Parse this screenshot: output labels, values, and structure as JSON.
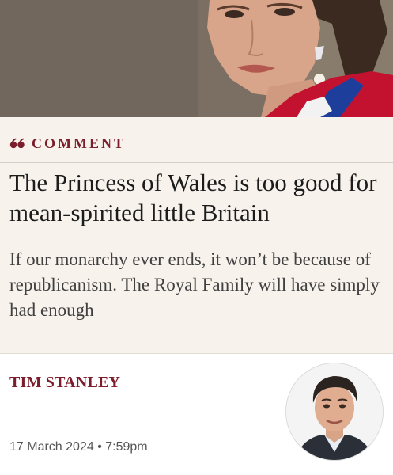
{
  "hero": {
    "image_icon": "portrait-photo"
  },
  "article": {
    "kicker": "COMMENT",
    "kicker_icon": "quote-icon",
    "headline": "The Princess of Wales is too good for mean-spirited little Britain",
    "standfirst": "If our monarchy ever ends, it won’t be because of republicanism. The Royal Family will have simply had enough",
    "author": "TIM STANLEY",
    "date": "17 March 2024",
    "separator": "•",
    "time": "7:59pm",
    "author_avatar_icon": "author-photo"
  },
  "colors": {
    "accent": "#7c1d2b",
    "band_background": "#f7f2ec",
    "headline": "#1c1c1c",
    "standfirst": "#404040"
  }
}
